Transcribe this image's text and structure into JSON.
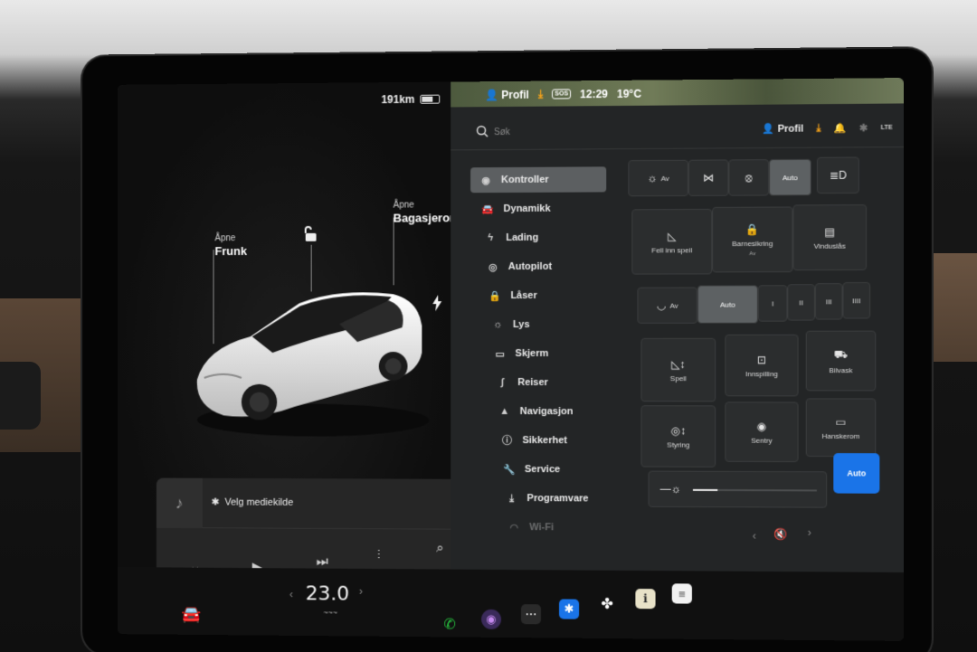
{
  "status": {
    "range": "191km",
    "profile": "Profil",
    "sos": "SOS",
    "time": "12:29",
    "outside_temp": "19°C",
    "lte": "LTE"
  },
  "car_view": {
    "frunk": {
      "action": "Åpne",
      "name": "Frunk"
    },
    "trunk": {
      "action": "Åpne",
      "name": "Bagasjerom"
    }
  },
  "media": {
    "source_label": "Velg mediekilde"
  },
  "bottom": {
    "temperature": "23.0",
    "temp_sub": "~~~"
  },
  "header": {
    "search_placeholder": "Søk",
    "profile": "Profil"
  },
  "menu": [
    {
      "label": "Kontroller",
      "icon": "toggle-icon",
      "glyph": "◉",
      "active": true
    },
    {
      "label": "Dynamikk",
      "icon": "car-icon",
      "glyph": "🚘"
    },
    {
      "label": "Lading",
      "icon": "bolt-icon",
      "glyph": "ϟ"
    },
    {
      "label": "Autopilot",
      "icon": "steering-wheel-icon",
      "glyph": "◎"
    },
    {
      "label": "Låser",
      "icon": "lock-icon",
      "glyph": "🔒"
    },
    {
      "label": "Lys",
      "icon": "sun-icon",
      "glyph": "☼"
    },
    {
      "label": "Skjerm",
      "icon": "display-icon",
      "glyph": "▭"
    },
    {
      "label": "Reiser",
      "icon": "trips-icon",
      "glyph": "∫"
    },
    {
      "label": "Navigasjon",
      "icon": "navigation-icon",
      "glyph": "▲"
    },
    {
      "label": "Sikkerhet",
      "icon": "info-icon",
      "glyph": "ⓘ"
    },
    {
      "label": "Service",
      "icon": "wrench-icon",
      "glyph": "🔧"
    },
    {
      "label": "Programvare",
      "icon": "download-icon",
      "glyph": "⤓"
    },
    {
      "label": "Wi-Fi",
      "icon": "wifi-icon",
      "glyph": "◠"
    }
  ],
  "lights": {
    "off": "Av",
    "auto": "Auto"
  },
  "controls": {
    "mirror_fold": "Fell inn speil",
    "child_lock": "Barnesikring",
    "child_lock_state": "Av",
    "window_lock": "Vinduslås"
  },
  "wipers": {
    "off": "Av",
    "auto": "Auto",
    "speed1": "I",
    "speed2": "II",
    "speed3": "III",
    "speed4": "IIII"
  },
  "bottom_controls": {
    "mirrors": "Speil",
    "recording": "Innspilling",
    "car_wash": "Bilvask",
    "steering": "Styring",
    "sentry": "Sentry",
    "glovebox": "Hanskerom",
    "brightness_auto": "Auto",
    "brightness_level": 0.2
  }
}
